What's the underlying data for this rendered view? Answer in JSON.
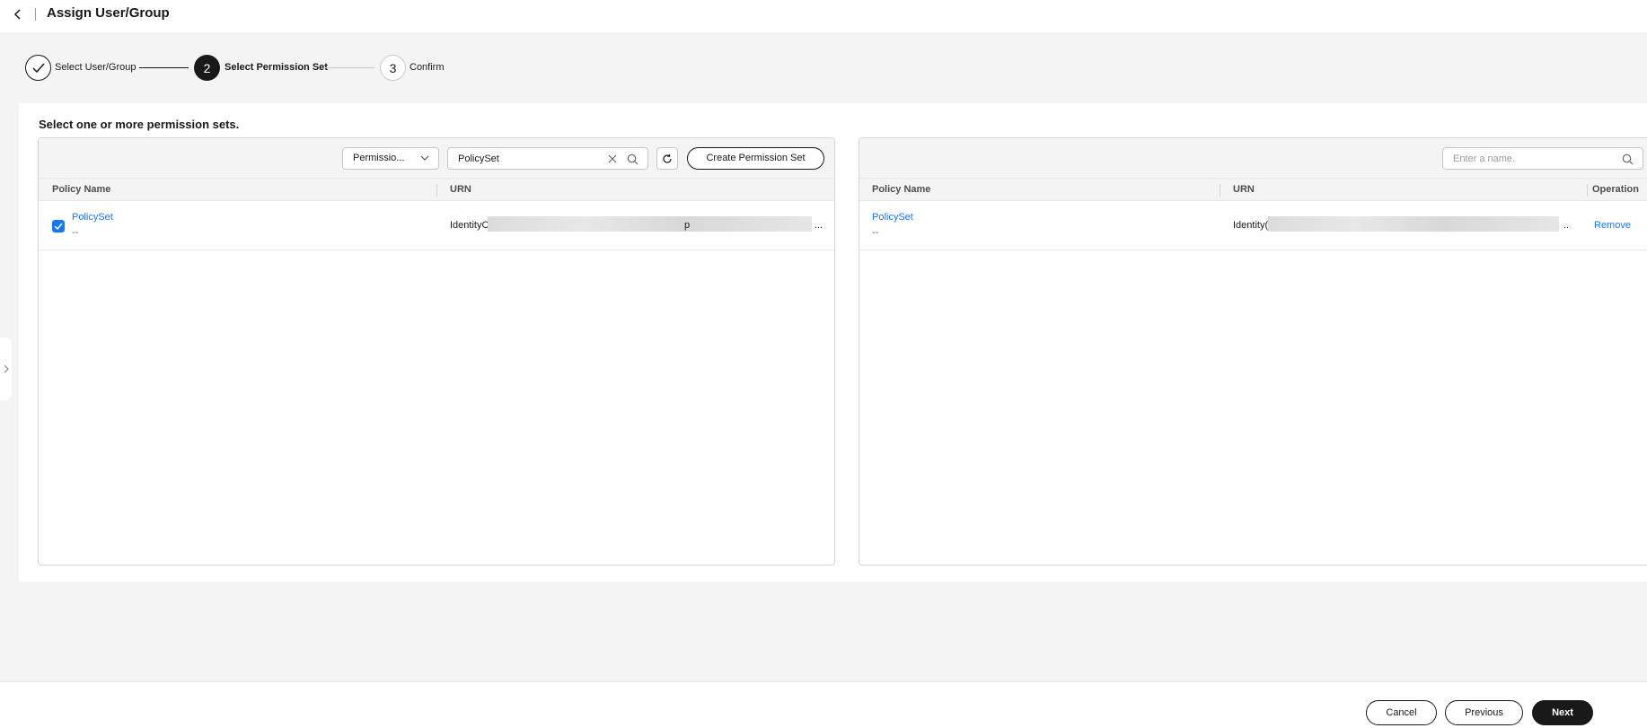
{
  "header": {
    "title": "Assign User/Group"
  },
  "steps": [
    {
      "number": "1",
      "label": "Select User/Group",
      "status": "done"
    },
    {
      "number": "2",
      "label": "Select Permission Set",
      "status": "active"
    },
    {
      "number": "3",
      "label": "Confirm",
      "status": "todo"
    }
  ],
  "card": {
    "title": "Select one or more permission sets."
  },
  "left_panel": {
    "filter_select": {
      "value": "Permissio..."
    },
    "search": {
      "value": "PolicySet"
    },
    "create_button": "Create Permission Set",
    "columns": [
      "Policy Name",
      "URN"
    ],
    "rows": [
      {
        "checked": true,
        "name": "PolicySet",
        "description": "--",
        "urn_prefix": "IdentityC",
        "urn_visible_fragment": "p",
        "urn_suffix": "..."
      }
    ]
  },
  "right_panel": {
    "search": {
      "placeholder": "Enter a name."
    },
    "columns": [
      "Policy Name",
      "URN",
      "Operation"
    ],
    "rows": [
      {
        "name": "PolicySet",
        "description": "--",
        "urn_prefix": "Identity(",
        "urn_suffix": "..",
        "action": "Remove"
      }
    ]
  },
  "footer": {
    "cancel": "Cancel",
    "previous": "Previous",
    "next": "Next"
  },
  "colors": {
    "accent": "#1476ff",
    "primary": "#191919",
    "background": "#f4f4f4"
  }
}
